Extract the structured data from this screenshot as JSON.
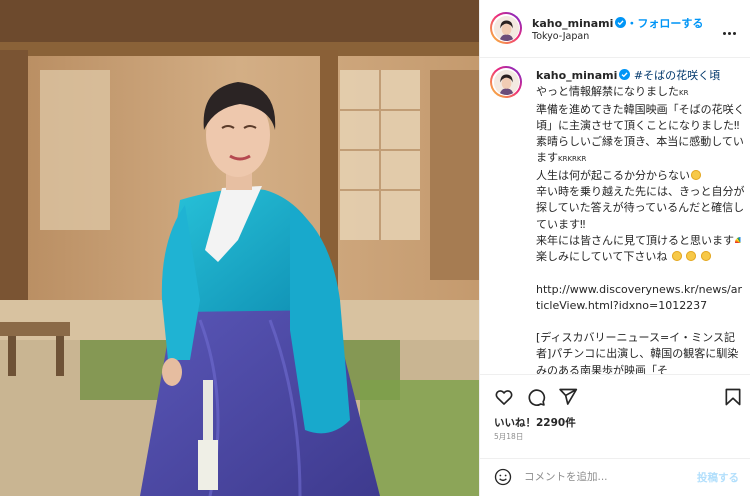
{
  "post": {
    "username": "kaho_minami",
    "follow_label": "・フォローする",
    "location": "Tokyo-Japan",
    "more_icon": "more-horizontal-icon"
  },
  "caption": {
    "username": "kaho_minami",
    "hashtag": "#そばの花咲く頃",
    "lines": [
      "やっと情報解禁になりました",
      "準備を進めてきた韓国映画「そばの花咲く頃」に主演させて頂くことになりました‼︎",
      "素晴らしいご縁を頂き、本当に感動しています",
      "人生は何が起こるか分からない",
      "辛い時を乗り越えた先には、きっと自分が探していた答えが待っているんだと確信しています‼︎",
      "来年には皆さんに見て頂けると思います",
      "楽しみにしていて下さいね",
      "http://www.discoverynews.kr/news/articleView.html?idxno=1012237",
      "[ディスカバリーニュース=イ・ミンス記者]パチンコに出演し、韓国の観客に馴染みのある南果歩が映画「そ"
    ],
    "kr_small": "KR",
    "krkrkr_small": "KRKRKR"
  },
  "actions": {
    "like_icon": "heart-icon",
    "comment_icon": "comment-icon",
    "share_icon": "send-icon",
    "save_icon": "bookmark-icon"
  },
  "likes_text": "いいね！2290件",
  "date_text": "5月18日",
  "comment": {
    "placeholder": "コメントを追加...",
    "post_label": "投稿する"
  },
  "colors": {
    "link_blue": "#0095f6",
    "hashtag": "#00376b",
    "post_disabled": "#b2dffc"
  }
}
